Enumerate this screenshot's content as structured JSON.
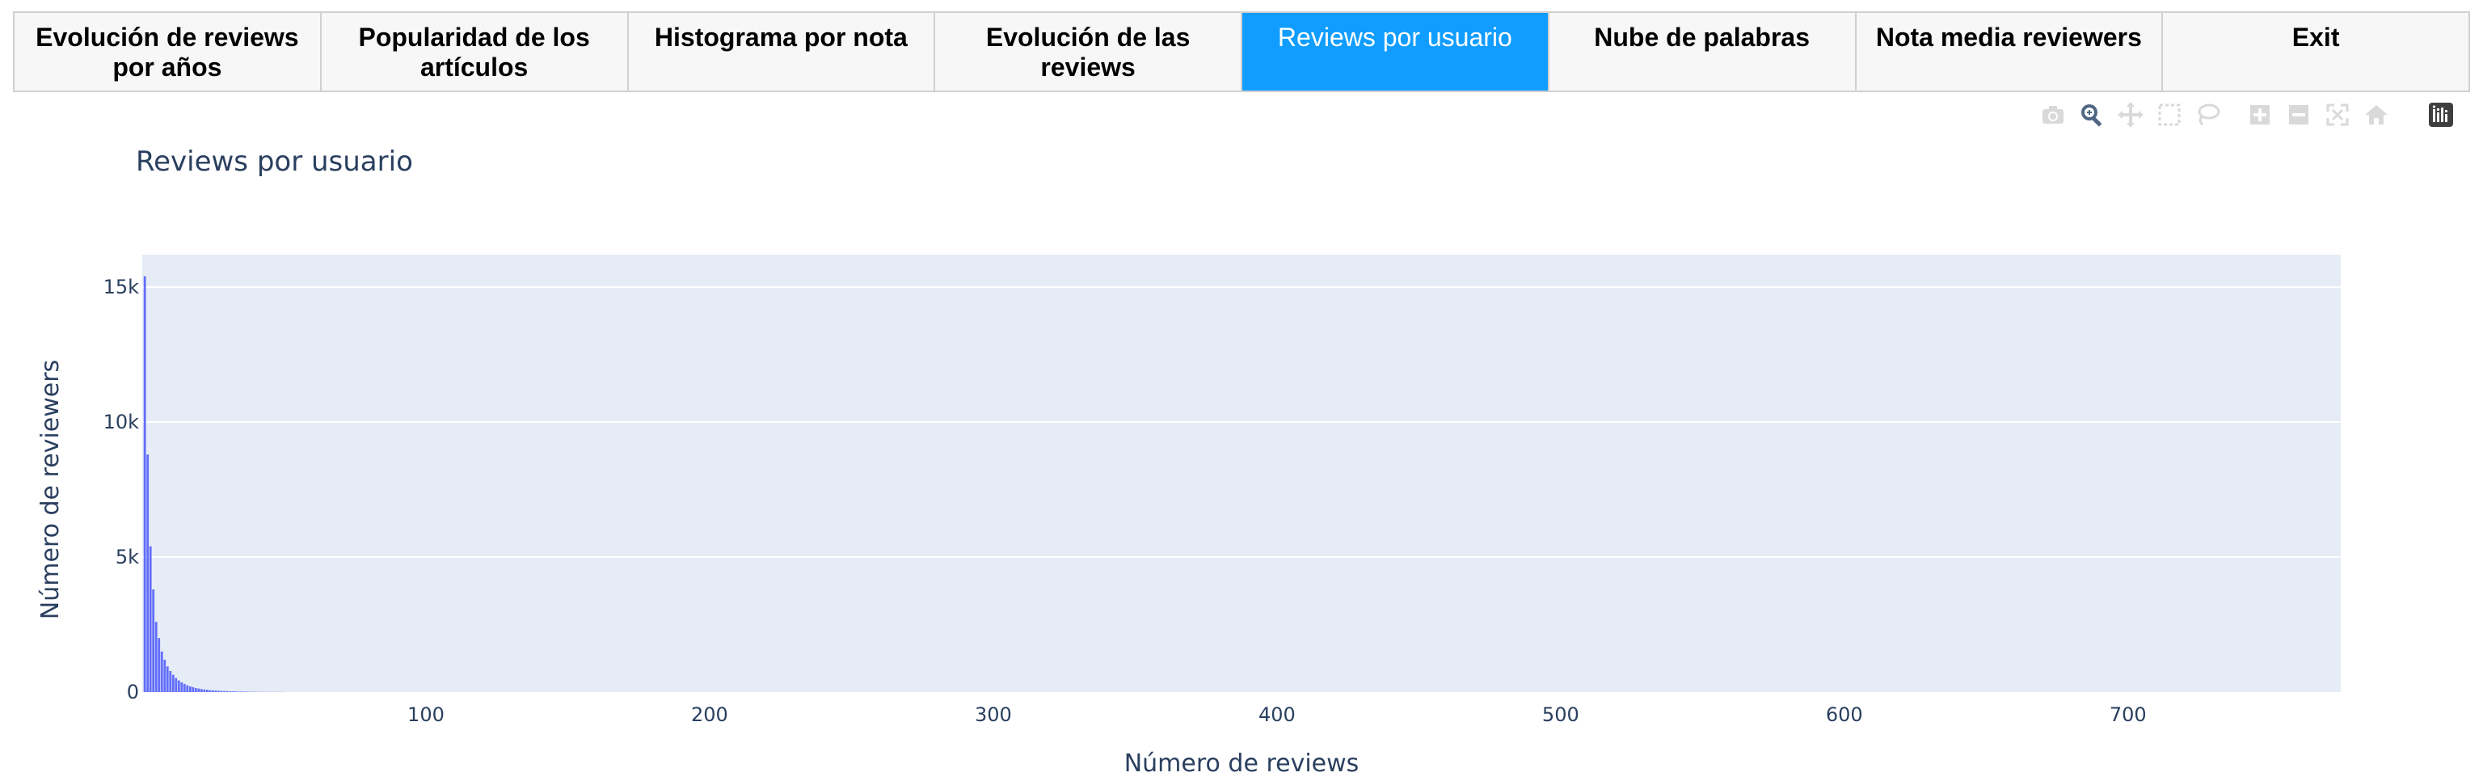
{
  "tabs": [
    {
      "label": "Evolución de reviews por años",
      "active": false
    },
    {
      "label": "Popularidad de los artículos",
      "active": false
    },
    {
      "label": "Histograma por nota",
      "active": false
    },
    {
      "label": "Evolución de las reviews",
      "active": false
    },
    {
      "label": "Reviews por usuario",
      "active": true
    },
    {
      "label": "Nube de palabras",
      "active": false
    },
    {
      "label": "Nota media reviewers",
      "active": false
    },
    {
      "label": "Exit",
      "active": false
    }
  ],
  "colors": {
    "tab_active": "#119dff",
    "plot_background": "#e5ecf6",
    "bar": "#636efa",
    "text": "#2a3f5f",
    "modebar_icon": "#d9d9d9"
  },
  "modebar": {
    "icons": [
      "camera-icon",
      "zoom-icon",
      "pan-icon",
      "box-select-icon",
      "lasso-select-icon",
      "zoom-in-icon",
      "zoom-out-icon",
      "autoscale-icon",
      "reset-axes-icon",
      "plotly-logo-icon"
    ]
  },
  "chart_data": {
    "type": "bar",
    "title": "Reviews por usuario",
    "xlabel": "Número de reviews",
    "ylabel": "Número de reviewers",
    "xlim": [
      0,
      775
    ],
    "ylim": [
      0,
      16200
    ],
    "xticks": [
      100,
      200,
      300,
      400,
      500,
      600,
      700
    ],
    "xtick_labels": [
      "100",
      "200",
      "300",
      "400",
      "500",
      "600",
      "700"
    ],
    "yticks": [
      0,
      5000,
      10000,
      15000
    ],
    "ytick_labels": [
      "0",
      "5k",
      "10k",
      "15k"
    ],
    "grid": true,
    "x": [
      1,
      2,
      3,
      4,
      5,
      6,
      7,
      8,
      9,
      10,
      11,
      12,
      13,
      14,
      15,
      16,
      17,
      18,
      19,
      20,
      21,
      22,
      23,
      24,
      25,
      26,
      27,
      28,
      29,
      30,
      31,
      32,
      33,
      34,
      35,
      36,
      37,
      38,
      39,
      40,
      41,
      42,
      43,
      44,
      45,
      46,
      47,
      48,
      49,
      50
    ],
    "values": [
      15400,
      8800,
      5400,
      3800,
      2600,
      2000,
      1500,
      1200,
      950,
      780,
      640,
      520,
      430,
      360,
      300,
      250,
      210,
      180,
      150,
      130,
      110,
      95,
      82,
      72,
      63,
      55,
      48,
      42,
      37,
      33,
      29,
      26,
      23,
      20,
      18,
      16,
      14,
      12,
      11,
      10,
      9,
      8,
      7,
      6,
      6,
      5,
      5,
      4,
      4,
      3
    ]
  }
}
